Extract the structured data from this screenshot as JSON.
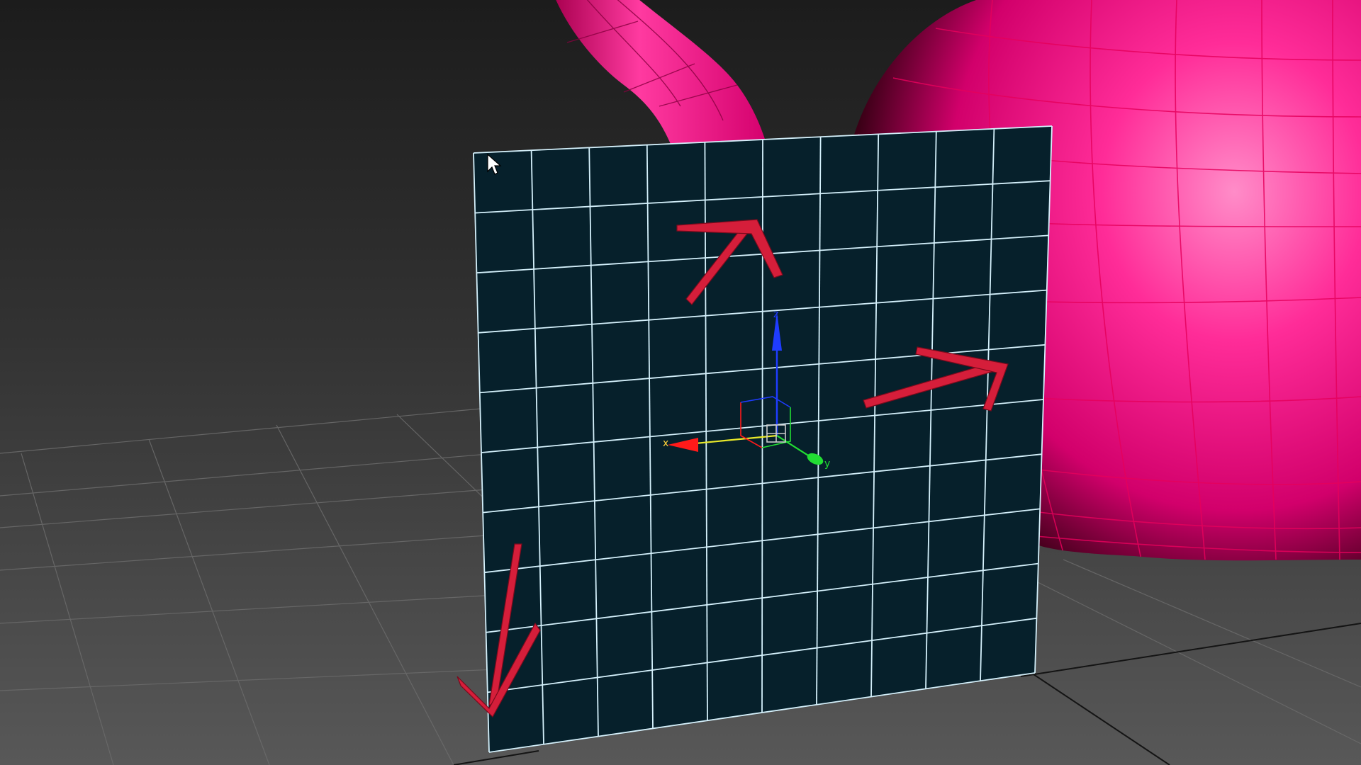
{
  "viewport": {
    "name": "3d-perspective-viewport",
    "background_top": "#1e1e1e",
    "background_bottom": "#5a5a5a",
    "grid_color": "#6b6b6b"
  },
  "objects": {
    "teapot_color": "#ff1f8f",
    "teapot_wire_color": "#e8005e",
    "plane_color": "#06202b",
    "plane_wire_color": "#cfeefa"
  },
  "gizmo": {
    "x_label": "x",
    "y_label": "y",
    "z_label": "z",
    "x_color": "#ff1a1a",
    "y_color": "#22dd33",
    "z_color": "#1f3cff"
  },
  "annotations": {
    "arrow_color": "#d51e3a"
  },
  "cursor": {
    "icon": "mouse-pointer-icon"
  }
}
